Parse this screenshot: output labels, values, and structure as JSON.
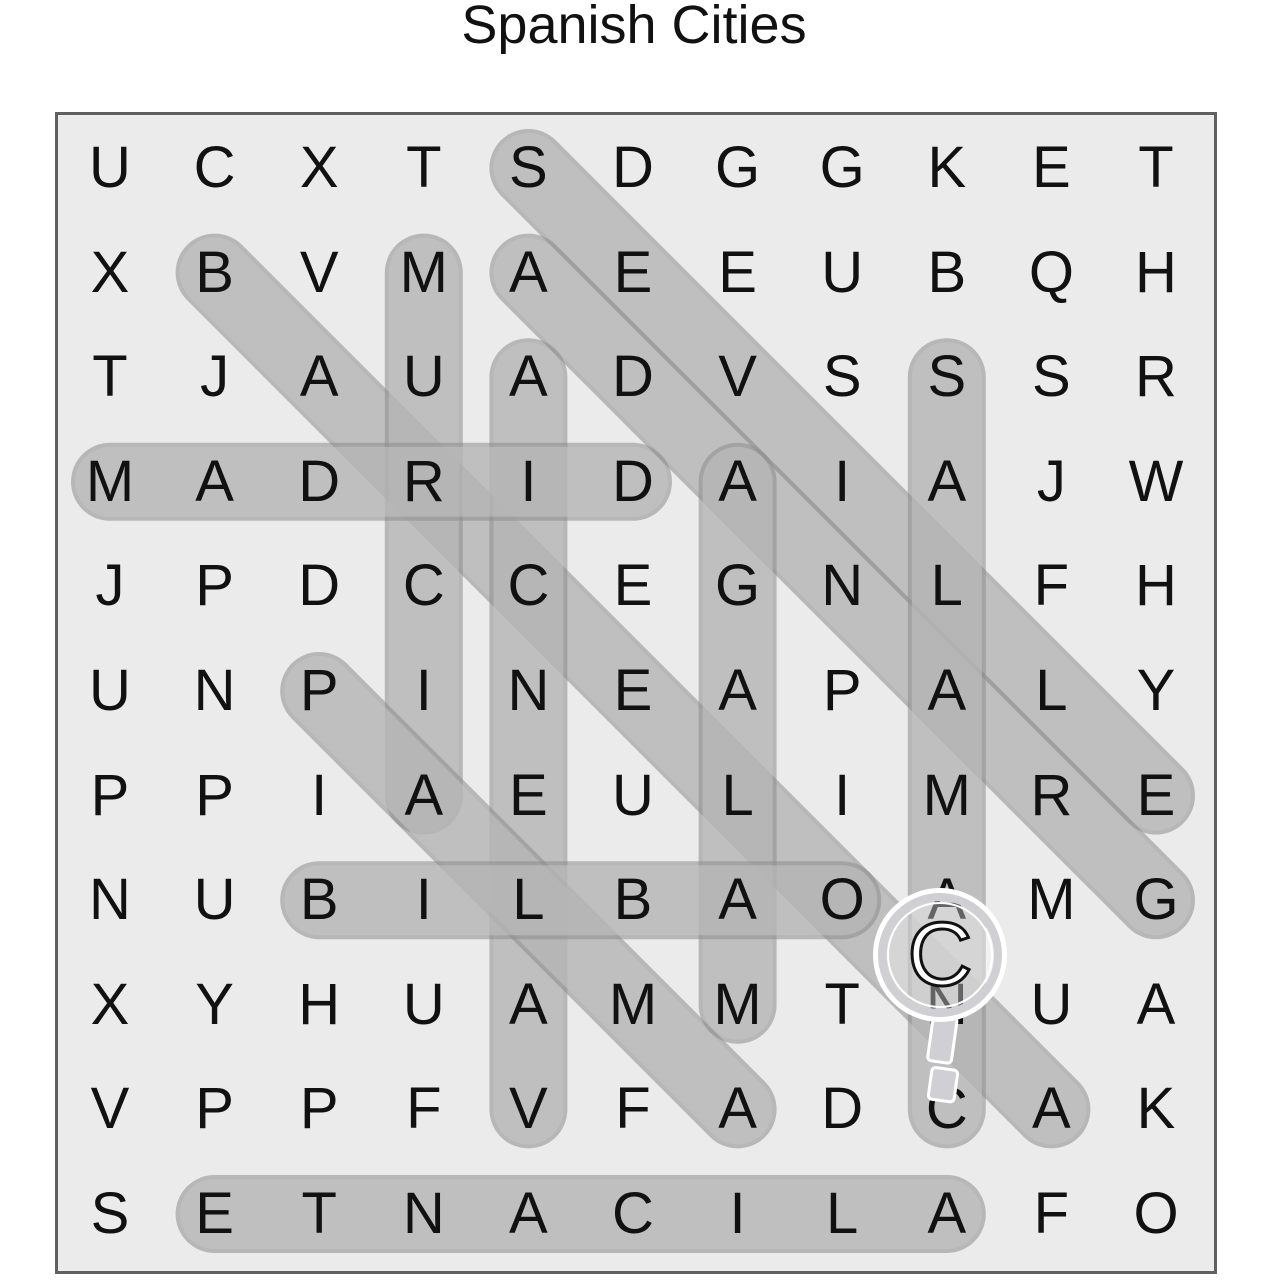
{
  "title": "Spanish Cities",
  "grid": [
    [
      "U",
      "C",
      "X",
      "T",
      "S",
      "D",
      "G",
      "G",
      "K",
      "E",
      "T"
    ],
    [
      "X",
      "B",
      "V",
      "M",
      "A",
      "E",
      "E",
      "U",
      "B",
      "Q",
      "H"
    ],
    [
      "T",
      "J",
      "A",
      "U",
      "A",
      "D",
      "V",
      "S",
      "S",
      "S",
      "R"
    ],
    [
      "M",
      "A",
      "D",
      "R",
      "I",
      "D",
      "A",
      "I",
      "A",
      "J",
      "W"
    ],
    [
      "J",
      "P",
      "D",
      "C",
      "C",
      "E",
      "G",
      "N",
      "L",
      "F",
      "H"
    ],
    [
      "U",
      "N",
      "P",
      "I",
      "N",
      "E",
      "A",
      "P",
      "A",
      "L",
      "Y"
    ],
    [
      "P",
      "P",
      "I",
      "A",
      "E",
      "U",
      "L",
      "I",
      "M",
      "R",
      "E"
    ],
    [
      "N",
      "U",
      "B",
      "I",
      "L",
      "B",
      "A",
      "O",
      "A",
      "M",
      "G"
    ],
    [
      "X",
      "Y",
      "H",
      "U",
      "A",
      "M",
      "M",
      "T",
      "N",
      "U",
      "A"
    ],
    [
      "V",
      "P",
      "P",
      "F",
      "V",
      "F",
      "A",
      "D",
      "C",
      "A",
      "K"
    ],
    [
      "S",
      "E",
      "T",
      "N",
      "A",
      "C",
      "I",
      "L",
      "A",
      "F",
      "O"
    ]
  ],
  "found_words": [
    {
      "word": "SEVILLE",
      "start": [
        0,
        4
      ],
      "end": [
        6,
        10
      ]
    },
    {
      "word": "GRANADA",
      "start": [
        1,
        4
      ],
      "end": [
        7,
        10
      ]
    },
    {
      "word": "BARCELONA",
      "start": [
        1,
        1
      ],
      "end": [
        9,
        9
      ]
    },
    {
      "word": "MURCIA",
      "start": [
        1,
        3
      ],
      "end": [
        6,
        3
      ]
    },
    {
      "word": "VALENCIA",
      "start": [
        2,
        4
      ],
      "end": [
        9,
        4
      ]
    },
    {
      "word": "SALAMANCA",
      "start": [
        2,
        8
      ],
      "end": [
        9,
        8
      ]
    },
    {
      "word": "MADRID",
      "start": [
        3,
        0
      ],
      "end": [
        3,
        5
      ]
    },
    {
      "word": "MALAGA",
      "start": [
        3,
        6
      ],
      "end": [
        8,
        6
      ]
    },
    {
      "word": "PALMA",
      "start": [
        5,
        2
      ],
      "end": [
        9,
        6
      ]
    },
    {
      "word": "BILBAO",
      "start": [
        7,
        2
      ],
      "end": [
        7,
        7
      ]
    },
    {
      "word": "ALICANTE",
      "start": [
        10,
        1
      ],
      "end": [
        10,
        8
      ]
    }
  ],
  "magnifier": {
    "letter": "C",
    "icon": "magnifier-icon"
  },
  "colors": {
    "highlight_fill": "#b4b4b4",
    "highlight_stroke": "#8c8c8c",
    "board_bg": "#ebebeb"
  }
}
